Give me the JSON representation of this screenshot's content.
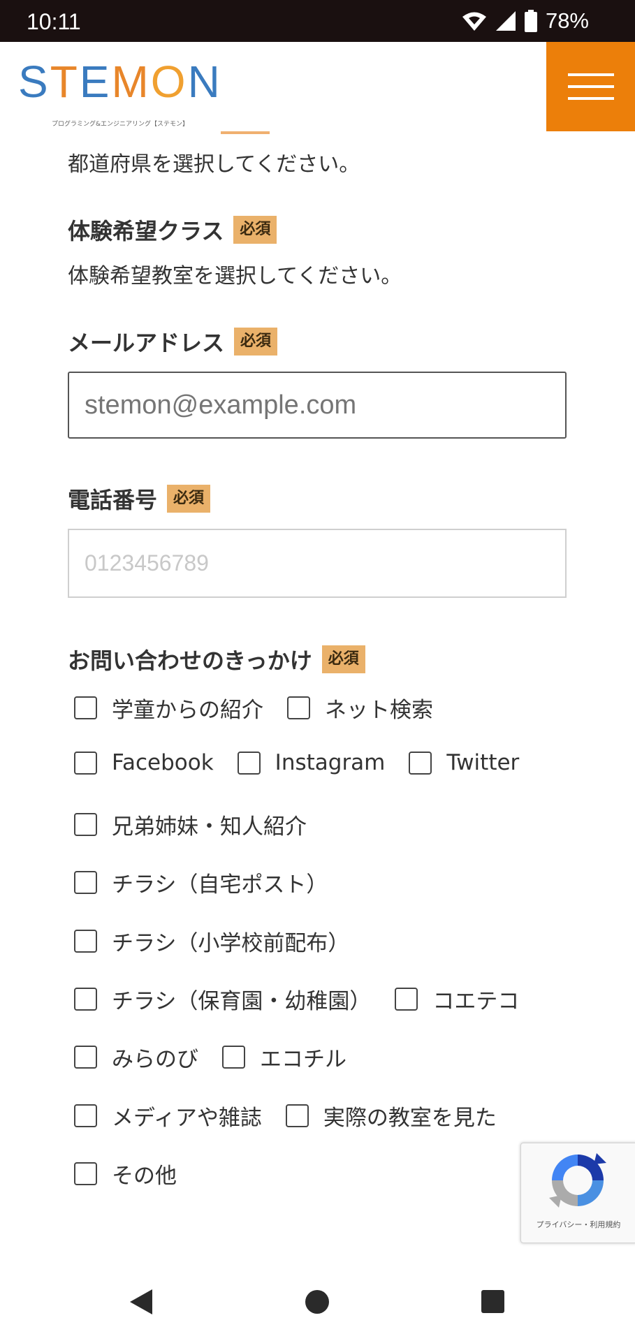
{
  "status_bar": {
    "time": "10:11",
    "battery": "78%",
    "icons": [
      "wifi-icon",
      "signal-icon",
      "battery-icon"
    ]
  },
  "header": {
    "logo_letters": [
      "S",
      "T",
      "E",
      "M",
      "O",
      "N"
    ],
    "logo_tagline": "プログラミング&エンジニアリング【ステモン】",
    "brand_color": "#ec7f0a"
  },
  "form": {
    "prefecture_help": "都道府県を選択してください。",
    "class_label": "体験希望クラス",
    "class_help": "体験希望教室を選択してください。",
    "email_label": "メールアドレス",
    "email_placeholder": "stemon@example.com",
    "phone_label": "電話番号",
    "phone_placeholder": "0123456789",
    "trigger_label": "お問い合わせのきっかけ",
    "required_badge": "必須",
    "checkbox_rows": [
      [
        "学童からの紹介",
        "ネット検索"
      ],
      [
        "Facebook",
        "Instagram",
        "Twitter"
      ],
      [
        "兄弟姉妹・知人紹介"
      ],
      [
        "チラシ（自宅ポスト）"
      ],
      [
        "チラシ（小学校前配布）"
      ],
      [
        "チラシ（保育園・幼稚園）",
        "コエテコ"
      ],
      [
        "みらのび",
        "エコチル"
      ],
      [
        "メディアや雑誌",
        "実際の教室を見た"
      ],
      [
        "その他"
      ]
    ]
  },
  "recaptcha": {
    "terms_text": "プライバシー・利用規約"
  },
  "colors": {
    "required_badge_bg": "#eab16a",
    "status_bar_bg": "#1a1010"
  }
}
